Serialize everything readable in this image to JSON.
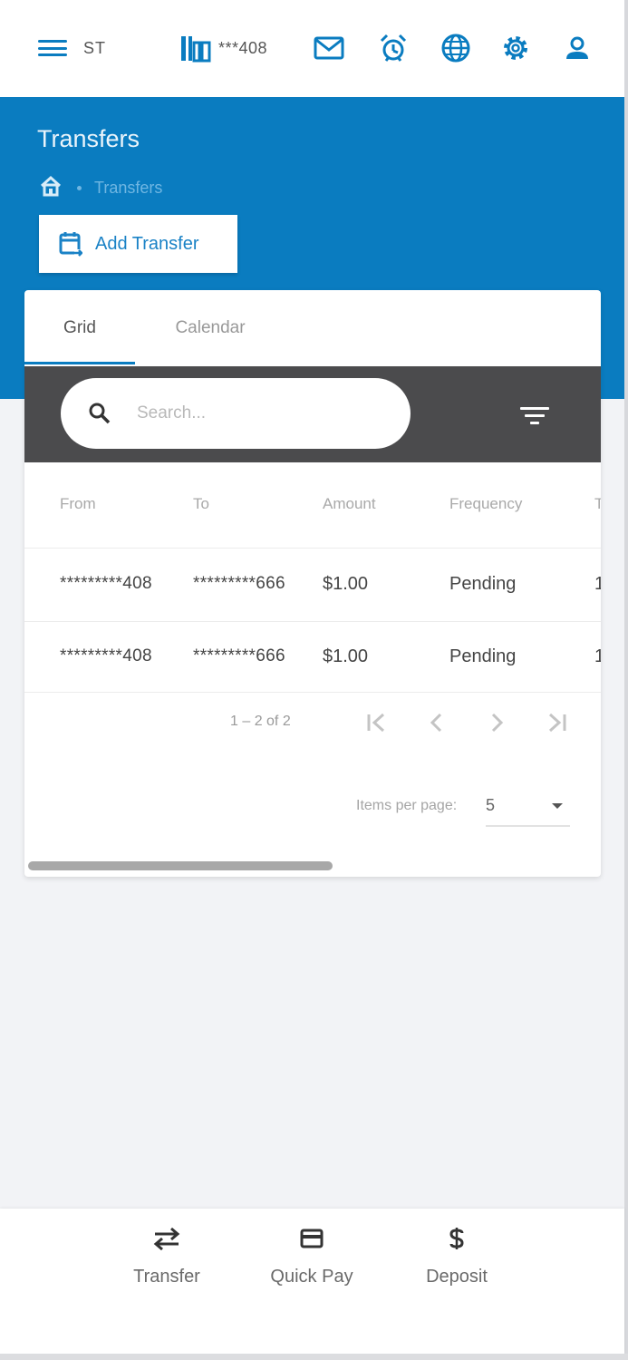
{
  "topbar": {
    "user_initials": "ST",
    "account_label": "***408",
    "icons": [
      "menu-icon",
      "bank-icon",
      "mail-icon",
      "alarm-icon",
      "globe-icon",
      "settings-icon",
      "user-icon"
    ]
  },
  "header": {
    "title": "Transfers",
    "breadcrumb": [
      "home-icon",
      "Transfers"
    ],
    "add_button_label": "Add Transfer"
  },
  "tabs": [
    {
      "label": "Grid",
      "active": true
    },
    {
      "label": "Calendar",
      "active": false
    }
  ],
  "search": {
    "placeholder": "Search..."
  },
  "table": {
    "columns": [
      "From",
      "To",
      "Amount",
      "Frequency",
      "T"
    ],
    "rows": [
      [
        "*********408",
        "*********666",
        "$1.00",
        "Pending",
        "1"
      ],
      [
        "*********408",
        "*********666",
        "$1.00",
        "Pending",
        "1"
      ]
    ]
  },
  "pagination": {
    "range_label": "1 – 2 of 2",
    "items_per_page_label": "Items per page:",
    "items_per_page_value": "5"
  },
  "bottom_nav": [
    {
      "label": "Transfer",
      "icon": "swap-arrows-icon"
    },
    {
      "label": "Quick Pay",
      "icon": "credit-card-icon"
    },
    {
      "label": "Deposit",
      "icon": "dollar-icon"
    }
  ],
  "colors": {
    "brand_blue": "#0a7cc0",
    "toolbar_dark": "#4b4b4d",
    "page_bg": "#f2f3f6"
  }
}
